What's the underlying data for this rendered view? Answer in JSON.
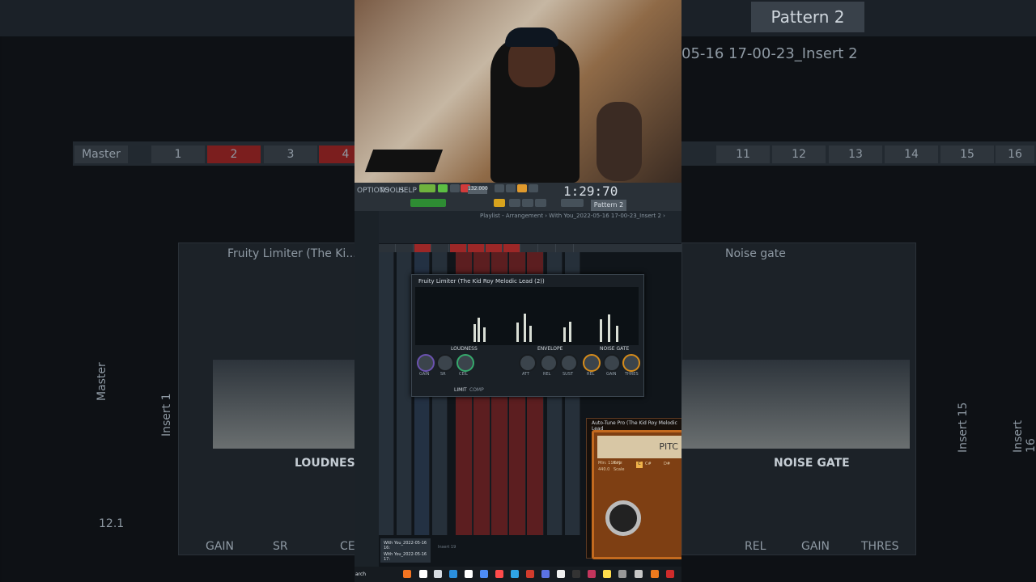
{
  "background": {
    "pattern_label": "Pattern 2",
    "top_path": "05-16 17-00-23_Insert 2",
    "left_panel_title": "Fruity Limiter (The Ki...",
    "right_panel_title": "Noise gate",
    "loudness": "LOUDNES",
    "noise_gate": "NOISE GATE",
    "left_knob_labels": [
      "GAIN",
      "SR",
      "CE"
    ],
    "right_knob_labels": [
      "REL",
      "GAIN",
      "THRES"
    ],
    "left_mixer_labels": [
      "Master",
      "1",
      "2",
      "3",
      "4"
    ],
    "right_mixer_labels": [
      "11",
      "12",
      "13",
      "14",
      "15",
      "16"
    ],
    "insert_labels": [
      "Master",
      "Insert 1",
      "Insert 15",
      "Insert 16"
    ],
    "small_values": [
      "12.1"
    ]
  },
  "center": {
    "menu": [
      "OPTIONS",
      "TOOLS",
      "HELP"
    ],
    "tempo": "132.000",
    "time": "1:29:70",
    "pattern": "Pattern 2",
    "playlist_title": "Playlist - Arrangement › With You_2022-05-16 17-00-23_Insert 2 ›",
    "limiter_title": "Fruity Limiter (The Kid Roy Melodic Lead (2))",
    "limiter_section_labels": [
      "LOUDNESS",
      "ENVELOPE",
      "NOISE GATE"
    ],
    "limiter_knob_labels": [
      "GAIN",
      "SR",
      "CEIL",
      "ATT",
      "REL",
      "SUST",
      "REL",
      "GAIN",
      "THRES"
    ],
    "limiter_buttons": [
      "LIMIT",
      "COMP"
    ],
    "autotune_title": "Auto-Tune Pro (The Kid Roy Melodic Lead",
    "autotune_screen": "PITC",
    "autotune_values": [
      "Min: 110 Hz",
      "440.0",
      "Key",
      "Scale",
      "C",
      "C#",
      "D#"
    ],
    "bottom_items": [
      "With You_2022-05-16 16:",
      "With You_2022-05-16 17:",
      "Insert 19"
    ],
    "taskbar_search": "arch"
  },
  "colors": {
    "accent_green": "#75d13a",
    "accent_red": "#8d1f22",
    "panel_dark": "#1a2026",
    "autotune_orange": "#c36a1f"
  }
}
